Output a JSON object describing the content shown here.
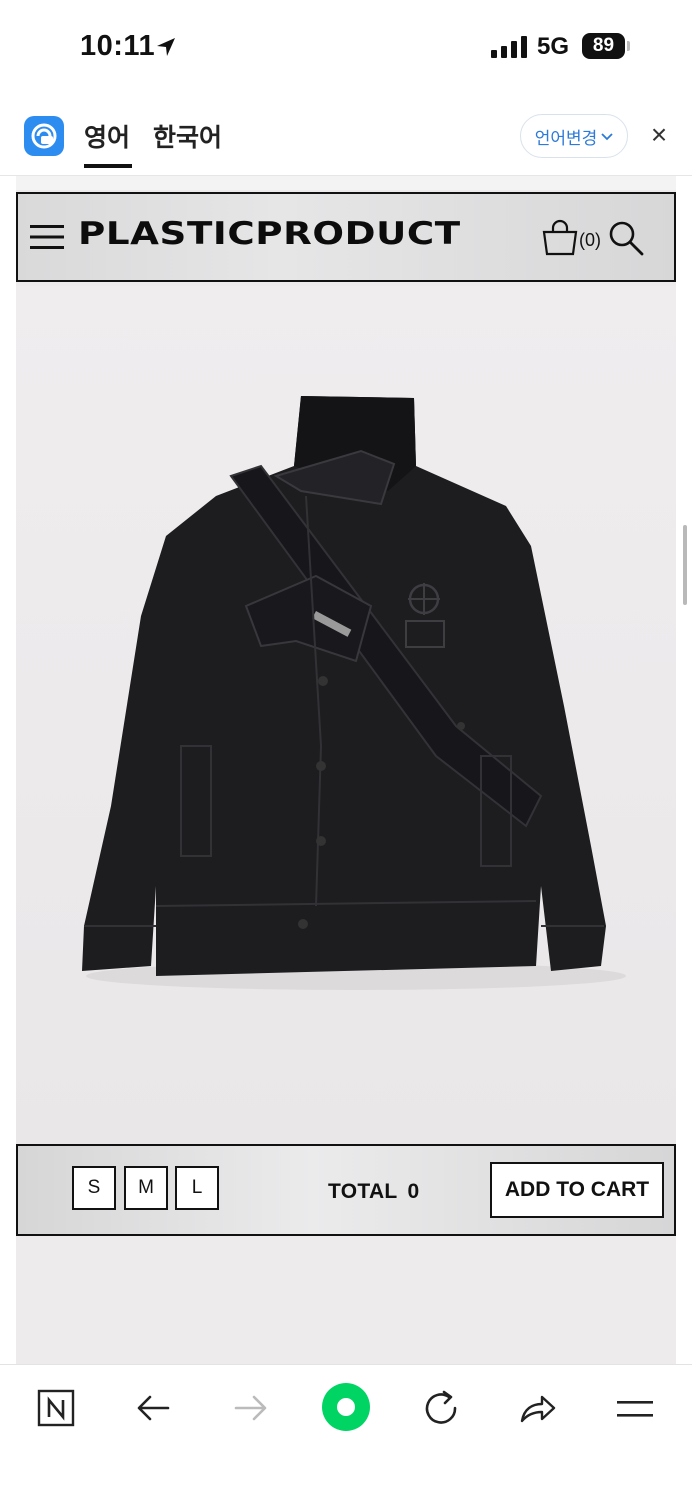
{
  "status_bar": {
    "time": "10:11",
    "network": "5G",
    "battery": "89"
  },
  "translator": {
    "tabs": [
      {
        "label": "영어",
        "active": true
      },
      {
        "label": "한국어",
        "active": false
      }
    ],
    "change_language_label": "언어변경",
    "close_label": "×"
  },
  "site_header": {
    "brand": "PLASTICPRODUCT",
    "cart_count": "(0)"
  },
  "product": {
    "image": "black-denim-jacket"
  },
  "buy_bar": {
    "sizes": [
      "S",
      "M",
      "L"
    ],
    "total_label": "TOTAL",
    "total_value": "0",
    "add_to_cart_label": "ADD TO CART"
  },
  "browser_bar": {
    "icons": [
      "naver-n-icon",
      "back-arrow-icon",
      "forward-arrow-icon",
      "green-dot-icon",
      "reload-icon",
      "share-icon",
      "menu-icon"
    ]
  },
  "colors": {
    "accent_blue": "#2d7ad8",
    "green": "#00d564",
    "page_bg": "#edebec"
  }
}
